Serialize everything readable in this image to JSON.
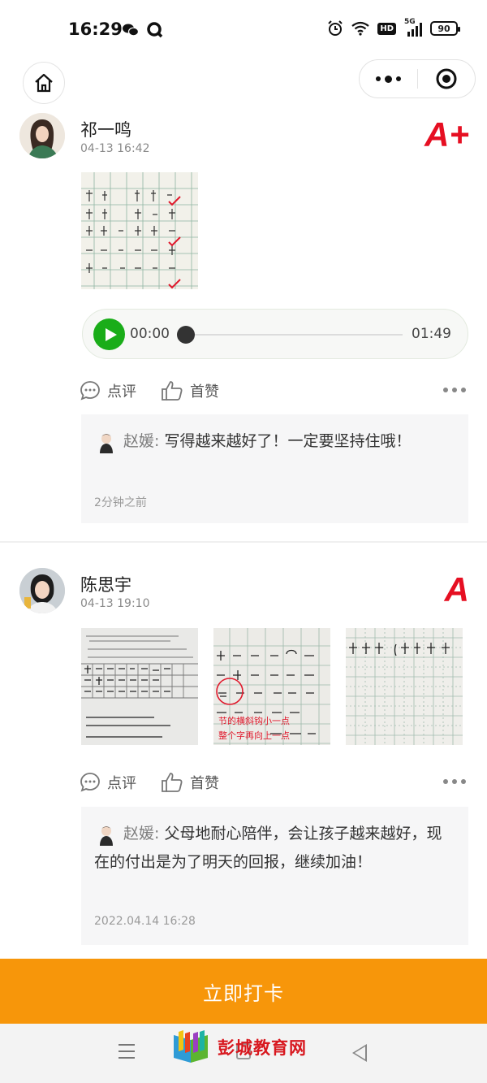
{
  "status_bar": {
    "time": "16:29",
    "network": "5G",
    "hd_label": "HD",
    "battery": "90"
  },
  "nav": {
    "home_icon": "home-icon",
    "more_icon": "more-dots-icon",
    "target_icon": "target-icon"
  },
  "posts": [
    {
      "name": "祁一鸣",
      "date": "04-13 16:42",
      "grade": "A+",
      "images": [
        "homework-photo"
      ],
      "audio": {
        "current": "00:00",
        "total": "01:49",
        "progress": 0
      },
      "actions": {
        "comment": "点评",
        "like": "首赞"
      },
      "comment": {
        "author": "赵媛:",
        "text": "写得越来越好了！一定要坚持住哦！",
        "time": "2分钟之前"
      }
    },
    {
      "name": "陈思宇",
      "date": "04-13 19:10",
      "grade": "A",
      "images": [
        "homework-photo-1",
        "homework-photo-2",
        "homework-photo-3"
      ],
      "image_annotation": [
        "节的横斜钩小一点",
        "整个字再向上一点"
      ],
      "actions": {
        "comment": "点评",
        "like": "首赞"
      },
      "comment": {
        "author": "赵媛:",
        "text": "父母地耐心陪伴，会让孩子越来越好，现在的付出是为了明天的回报，继续加油！",
        "time": "2022.04.14 16:28"
      }
    }
  ],
  "checkin_button": "立即打卡",
  "watermark": {
    "text": "彭城教育网"
  },
  "colors": {
    "accent": "#f7960a",
    "grade": "#e60f22",
    "play": "#1aad19"
  }
}
